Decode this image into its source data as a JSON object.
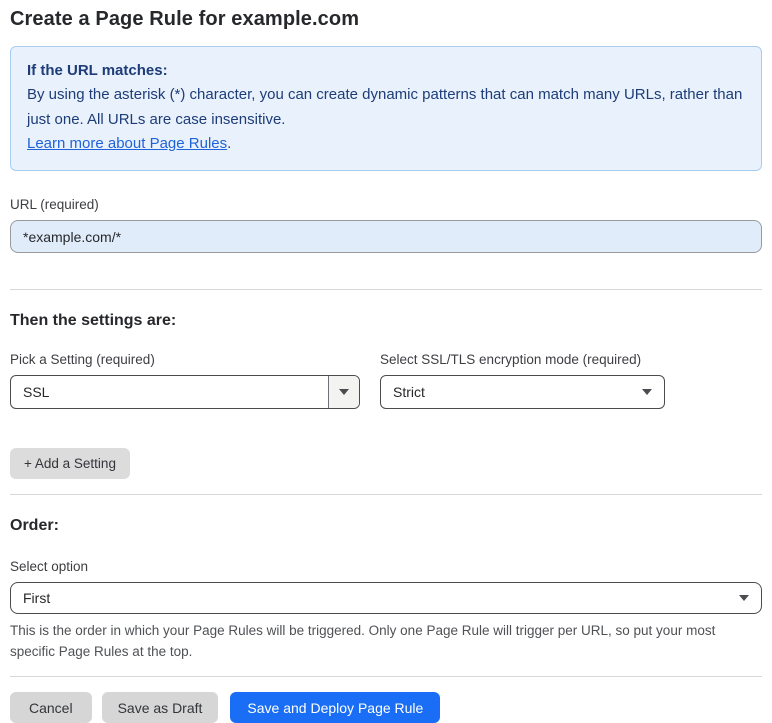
{
  "page_title": "Create a Page Rule for example.com",
  "info_box": {
    "heading": "If the URL matches:",
    "body": "By using the asterisk (*) character, you can create dynamic patterns that can match many URLs, rather than just one. All URLs are case insensitive.",
    "link_label": "Learn more about Page Rules",
    "link_suffix": "."
  },
  "url_section": {
    "label": "URL (required)",
    "value": "*example.com/*"
  },
  "settings_section": {
    "heading": "Then the settings are:",
    "pick_setting": {
      "label": "Pick a Setting (required)",
      "selected": "SSL"
    },
    "ssl_mode": {
      "label": "Select SSL/TLS encryption mode (required)",
      "selected": "Strict"
    },
    "add_setting_label": "+ Add a Setting"
  },
  "order_section": {
    "heading": "Order:",
    "select_label": "Select option",
    "selected": "First",
    "helper_text": "This is the order in which your Page Rules will be triggered. Only one Page Rule will trigger per URL, so put your most specific Page Rules at the top."
  },
  "footer": {
    "cancel_label": "Cancel",
    "save_draft_label": "Save as Draft",
    "save_deploy_label": "Save and Deploy Page Rule"
  },
  "colors": {
    "accent_blue": "#1a6ef5",
    "info_background": "#e9f2fc",
    "info_border": "#a9cdf0",
    "info_text": "#1d3c78",
    "link_blue": "#2062d8",
    "url_input_background": "#e1ecfb"
  }
}
